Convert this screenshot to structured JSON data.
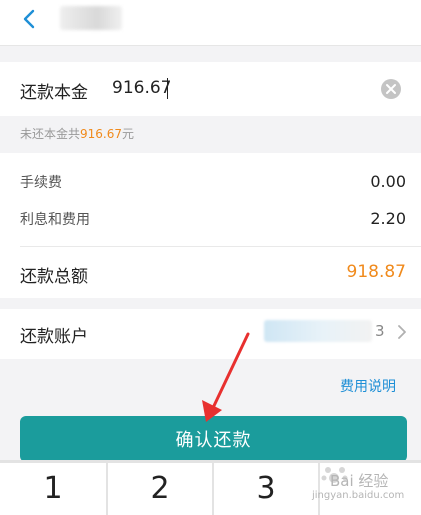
{
  "header": {
    "back_icon": "chevron-left-icon"
  },
  "principal": {
    "label": "还款本金",
    "value": "916.67"
  },
  "hint": {
    "prefix": "未还本金共",
    "amount": "916.67",
    "suffix": "元"
  },
  "fees": {
    "handling_fee": {
      "label": "手续费",
      "value": "0.00"
    },
    "interest": {
      "label": "利息和费用",
      "value": "2.20"
    }
  },
  "total": {
    "label": "还款总额",
    "value": "918.87"
  },
  "account": {
    "label": "还款账户",
    "tail": "3"
  },
  "fee_link": "费用说明",
  "confirm": {
    "label": "确认还款"
  },
  "keypad": {
    "keys": [
      "1",
      "2",
      "3"
    ]
  },
  "watermark": {
    "text": "Bai 经验",
    "sub": "jingyan.baidu.com"
  },
  "colors": {
    "accent_orange": "#f08a1c",
    "primary_teal": "#1b9c9c",
    "link_blue": "#1e8fd6",
    "arrow_red": "#e8302f"
  }
}
